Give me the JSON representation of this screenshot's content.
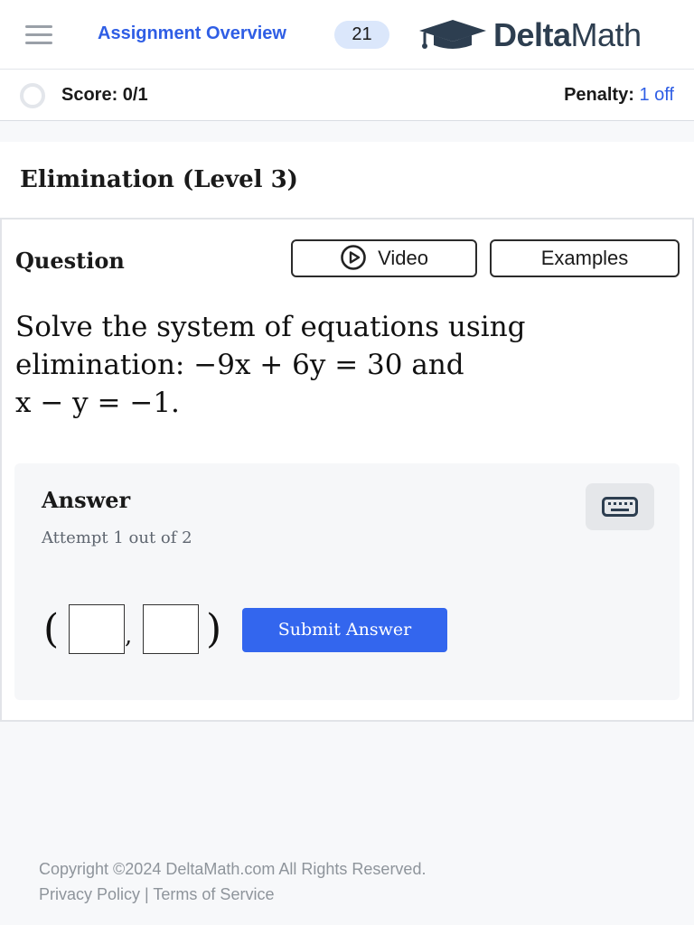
{
  "header": {
    "assignment_link": "Assignment Overview",
    "count": "21",
    "logo_bold": "Delta",
    "logo_light": "Math"
  },
  "scorebar": {
    "score_label": "Score: 0/1",
    "penalty_label": "Penalty:",
    "penalty_value": "1 off"
  },
  "problem": {
    "title": "Elimination (Level 3)",
    "question_label": "Question",
    "video_label": "Video",
    "examples_label": "Examples",
    "text_line1": "Solve the system of equations using",
    "text_line2_prefix": "elimination:",
    "eq1": "−9x + 6y = 30",
    "joiner": "and",
    "eq2": "x − y = −1."
  },
  "answer": {
    "title": "Answer",
    "attempt": "Attempt 1 out of 2",
    "open_paren": "(",
    "comma": ",",
    "close_paren": ")",
    "submit_label": "Submit Answer"
  },
  "footer": {
    "copyright": "Copyright ©2024 DeltaMath.com All Rights Reserved.",
    "privacy": "Privacy Policy",
    "separator": "|",
    "terms": "Terms of Service"
  },
  "icons": {
    "menu": "hamburger-icon",
    "logo": "graduation-cap-icon",
    "video": "play-circle-icon",
    "keyboard": "keyboard-icon"
  },
  "colors": {
    "accent": "#2f5ee5",
    "submit": "#3366ee",
    "badge": "#dbe7fb",
    "logo": "#2d3e50"
  }
}
